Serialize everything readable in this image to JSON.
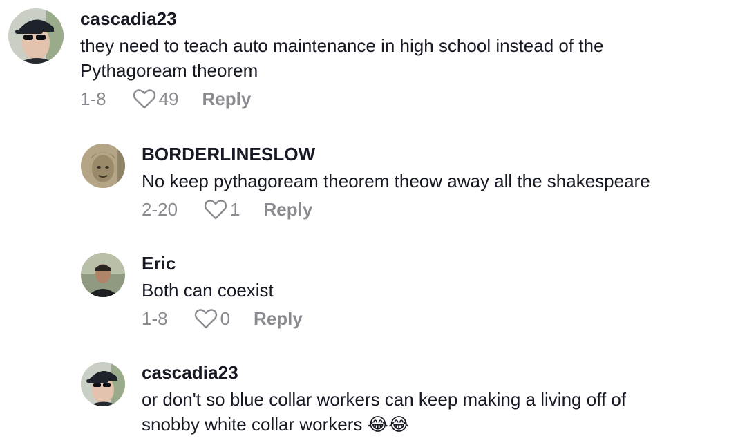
{
  "comments": [
    {
      "username": "cascadia23",
      "text_line1": "they need to teach auto maintenance in high school instead of the",
      "text_line2": "Pythagoream theorem",
      "date": "1-8",
      "likes": "49",
      "reply_label": "Reply",
      "avatar_icon": "avatar-cap-sunglasses-icon"
    },
    {
      "username": "BORDERLINESLOW",
      "text": "No keep pythagoream theorem theow away all the shakespeare",
      "date": "2-20",
      "likes": "1",
      "reply_label": "Reply",
      "avatar_icon": "avatar-banknote-portrait-icon"
    },
    {
      "username": "Eric",
      "text": "Both can coexist",
      "date": "1-8",
      "likes": "0",
      "reply_label": "Reply",
      "avatar_icon": "avatar-person-icon"
    },
    {
      "username": "cascadia23",
      "text_line1": "or don't so blue collar workers can keep making a living off of",
      "text_line2": "snobby white collar workers",
      "emoji": "😂😂",
      "avatar_icon": "avatar-cap-sunglasses-icon"
    }
  ],
  "colors": {
    "primary_text": "#161823",
    "secondary_text": "#8a8b91",
    "background": "#ffffff"
  }
}
